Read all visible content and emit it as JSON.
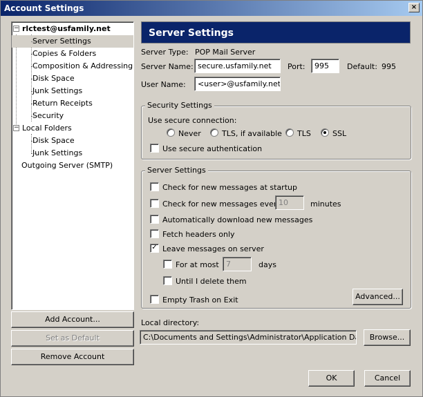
{
  "window": {
    "title": "Account Settings",
    "close_glyph": "×"
  },
  "tree": {
    "items": [
      {
        "label": "rlctest@usfamily.net",
        "expander": "−"
      },
      {
        "label": "Server Settings"
      },
      {
        "label": "Copies & Folders"
      },
      {
        "label": "Composition & Addressing"
      },
      {
        "label": "Disk Space"
      },
      {
        "label": "Junk Settings"
      },
      {
        "label": "Return Receipts"
      },
      {
        "label": "Security"
      },
      {
        "label": "Local Folders",
        "expander": "−"
      },
      {
        "label": "Disk Space"
      },
      {
        "label": "Junk Settings"
      },
      {
        "label": "Outgoing Server (SMTP)"
      }
    ],
    "selected_index": 1
  },
  "account_buttons": {
    "add": "Add Account...",
    "default": "Set as Default",
    "remove": "Remove Account"
  },
  "panel": {
    "header": "Server Settings",
    "server_type_label": "Server Type:",
    "server_type_value": "POP Mail Server",
    "server_name_label": "Server Name:",
    "server_name_value": "secure.usfamily.net",
    "port_label": "Port:",
    "port_value": "995",
    "default_label": "Default:",
    "default_value": "995",
    "user_name_label": "User Name:",
    "user_name_value": "<user>@usfamily.net"
  },
  "security": {
    "legend": "Security Settings",
    "use_secure_label": "Use secure connection:",
    "options": [
      "Never",
      "TLS, if available",
      "TLS",
      "SSL"
    ],
    "selected": "SSL",
    "secure_auth_label": "Use secure authentication",
    "secure_auth_checked": false
  },
  "server_settings": {
    "legend": "Server Settings",
    "check_startup_label": "Check for new messages at startup",
    "check_startup_checked": false,
    "check_every_label": "Check for new messages every",
    "check_every_value": "10",
    "check_every_unit": "minutes",
    "check_every_checked": false,
    "auto_download_label": "Automatically download new messages",
    "auto_download_checked": false,
    "fetch_headers_label": "Fetch headers only",
    "fetch_headers_checked": false,
    "leave_on_server_label": "Leave messages on server",
    "leave_on_server_checked": true,
    "for_at_most_label": "For at most",
    "for_at_most_value": "7",
    "for_at_most_unit": "days",
    "for_at_most_checked": false,
    "until_delete_label": "Until I delete them",
    "until_delete_checked": false,
    "empty_trash_label": "Empty Trash on Exit",
    "empty_trash_checked": false,
    "advanced_button": "Advanced..."
  },
  "local_directory": {
    "label": "Local directory:",
    "value": "C:\\Documents and Settings\\Administrator\\Application Data\\Thur",
    "browse_button": "Browse..."
  },
  "dialog_buttons": {
    "ok": "OK",
    "cancel": "Cancel"
  },
  "check_glyph": "✓"
}
